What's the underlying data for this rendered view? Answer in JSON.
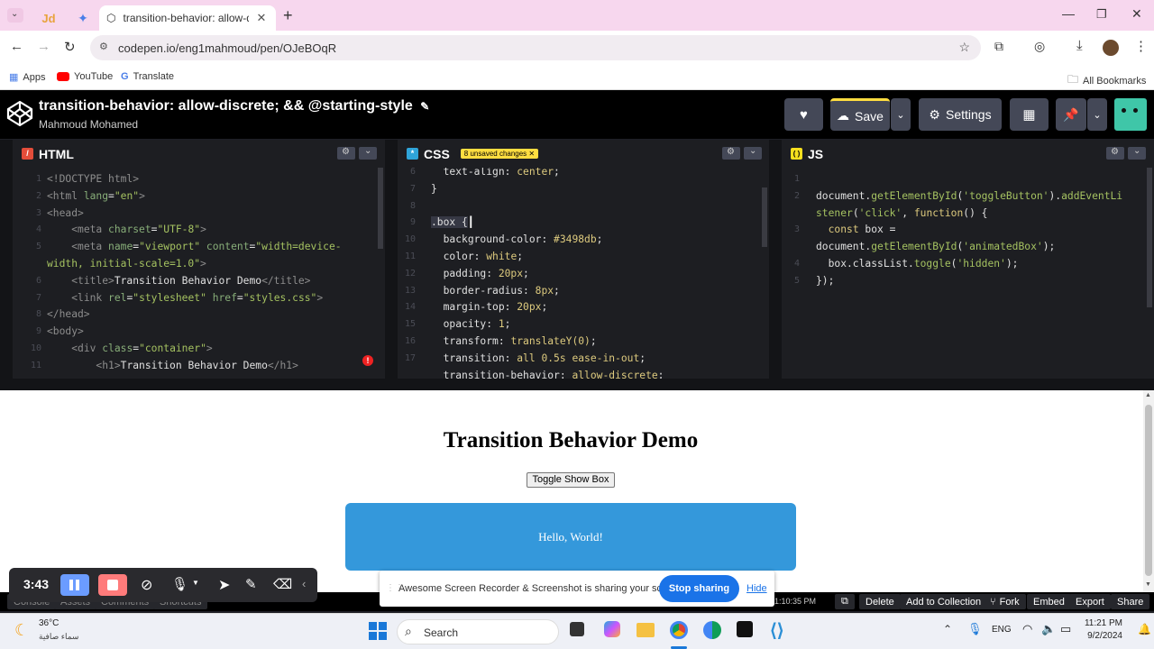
{
  "browser": {
    "tabs": [
      {
        "label": "Jd"
      },
      {
        "label": "✦"
      },
      {
        "label": "transition-behavior: allow-discr"
      }
    ],
    "url": "codepen.io/eng1mahmoud/pen/OJeBOqR",
    "bookmarks": [
      "Apps",
      "YouTube",
      "Translate"
    ],
    "all_bookmarks": "All Bookmarks"
  },
  "codepen": {
    "title": "transition-behavior: allow-discrete; && @starting-style",
    "author": "Mahmoud Mohamed",
    "save_label": "Save",
    "settings_label": "Settings"
  },
  "editors": {
    "html_label": "HTML",
    "css_label": "CSS",
    "js_label": "JS",
    "unsaved_badge": "8 unsaved changes ✕"
  },
  "preview": {
    "heading": "Transition Behavior Demo",
    "toggle_button": "Toggle Show Box",
    "box_text": "Hello, World!"
  },
  "footer": {
    "time": "1:10:35 PM",
    "buttons": [
      "Delete",
      "Add to Collection",
      "Fork",
      "Embed",
      "Export",
      "Share"
    ],
    "left_tabs": [
      "Console",
      "Assets",
      "Comments",
      "Shortcuts"
    ]
  },
  "recorder": {
    "timer": "3:43"
  },
  "sharing": {
    "message": "Awesome Screen Recorder & Screenshot is sharing your screen.",
    "stop": "Stop sharing",
    "hide": "Hide"
  },
  "taskbar": {
    "weather_temp": "36°C",
    "weather_text": "سماء صافية",
    "search_placeholder": "Search",
    "lang": "ENG",
    "time": "11:21 PM",
    "date": "9/2/2024"
  },
  "colors": {
    "box_blue": "#3498db",
    "codepen_black": "#000000",
    "stop_blue": "#1a73e8"
  }
}
